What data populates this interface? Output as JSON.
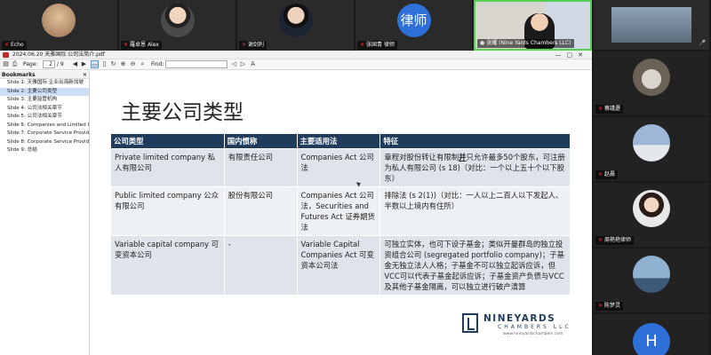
{
  "meeting": {
    "top_participants": [
      {
        "name": "Echo",
        "muted": true
      },
      {
        "name": "羅卓恩 Alex",
        "muted": true
      },
      {
        "name": "谢剑利",
        "muted": true
      },
      {
        "name": "张国青 律师",
        "muted": true,
        "avatar_text": "律师"
      },
      {
        "name": "张耀 (Nine Yards Chambers LLC)",
        "muted": false
      }
    ],
    "gallery": [
      {
        "name": "蔡謹瀝",
        "muted": true
      },
      {
        "name": "赵晨",
        "muted": true
      },
      {
        "name": "周艳艳律师",
        "muted": true
      },
      {
        "name": "陈梦灵",
        "muted": true
      },
      {
        "name": "",
        "muted": false,
        "avatar_text": "H"
      }
    ]
  },
  "viewer": {
    "window_title": "2024.06.20 天雅国际 公司法简介.pdf",
    "page_label": "Page:",
    "page_current": "2",
    "page_total": "/ 9",
    "find_label": "Find:",
    "find_value": "",
    "bookmarks_title": "Bookmarks",
    "bookmarks": [
      "Slide 1: 天雅国际 企业出海新加坡",
      "Slide 2: 主要公司类型",
      "Slide 3: 主要监管机构",
      "Slide 4: 公司法相关章节",
      "Slide 5: 公司法相关章节",
      "Slide 6: Companies and Limited L",
      "Slide 7: Corporate Service Provide",
      "Slide 8: Corporate Service Provide",
      "Slide 9: 总结"
    ],
    "selected_bookmark": 1
  },
  "slide": {
    "title": "主要公司类型",
    "headers": [
      "公司类型",
      "国内惯称",
      "主要适用法",
      "特征"
    ],
    "rows": [
      {
        "type": "Private limited company 私人有限公司",
        "domestic": "有限责任公司",
        "law": "Companies Act 公司法",
        "feature_pre": "章程对股份转让有限制",
        "feature_mark": "并",
        "feature_post": "只允许最多50个股东，可注册为私人有限公司 (s 18)（对比：一个以上五十个以下股东）"
      },
      {
        "type": "Public limited company 公众有限公司",
        "domestic": "股份有限公司",
        "law": "Companies Act 公司法，Securities and Futures Act 证券期货法",
        "feature": "排除法 (s 2(1))（对比：一人以上二百人以下发起人、半数以上境内有住所）"
      },
      {
        "type": "Variable capital company 可变资本公司",
        "domestic": "-",
        "law": "Variable Capital Companies Act 可变资本公司法",
        "feature": "可独立实体，也可下设子基金；类似开曼群岛的独立投资组合公司 (segregated portfolio company)；子基金无独立法人人格；子基金不可以独立起诉应诉，但VCC可以代表子基金起诉应诉；子基金资产负债与VCC及其他子基金隔离，可以独立进行破产清算"
      }
    ],
    "logo_name": "NINEYARDS",
    "logo_sub": "CHAMBERS LLC",
    "logo_url": "www.nineyardschambers.com"
  }
}
